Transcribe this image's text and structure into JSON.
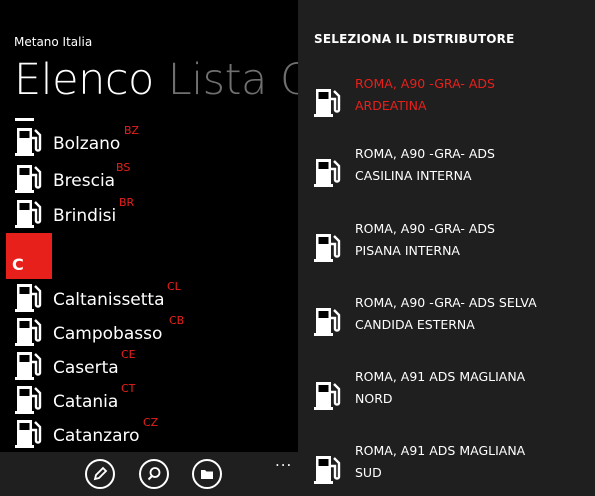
{
  "app": {
    "title": "Metano Italia",
    "pivot_active": "Elenco",
    "pivot_next": "Lista Ce"
  },
  "cities": [
    {
      "name": "Bolzano",
      "abbr": "BZ"
    },
    {
      "name": "Brescia",
      "abbr": "BS"
    },
    {
      "name": "Brindisi",
      "abbr": "BR"
    },
    {
      "name": "Caltanissetta",
      "abbr": "CL"
    },
    {
      "name": "Campobasso",
      "abbr": "CB"
    },
    {
      "name": "Caserta",
      "abbr": "CE"
    },
    {
      "name": "Catania",
      "abbr": "CT"
    },
    {
      "name": "Catanzaro",
      "abbr": "CZ"
    }
  ],
  "group_header": "C",
  "appbar": {
    "buttons": [
      "pencil-icon",
      "search-icon",
      "folder-icon"
    ],
    "more": "..."
  },
  "popup": {
    "title": "SELEZIONA IL DISTRIBUTORE",
    "stations": [
      {
        "line1": "ROMA, A90 -GRA- ADS",
        "line2": "ARDEATINA",
        "selected": true
      },
      {
        "line1": "ROMA, A90 -GRA- ADS",
        "line2": "CASILINA INTERNA",
        "selected": false
      },
      {
        "line1": "ROMA, A90 -GRA- ADS",
        "line2": "PISANA INTERNA",
        "selected": false
      },
      {
        "line1": "ROMA, A90 -GRA- ADS SELVA",
        "line2": "CANDIDA ESTERNA",
        "selected": false
      },
      {
        "line1": "ROMA, A91 ADS MAGLIANA",
        "line2": "NORD",
        "selected": false
      },
      {
        "line1": "ROMA, A91 ADS MAGLIANA",
        "line2": "SUD",
        "selected": false
      }
    ]
  },
  "colors": {
    "accent": "#e8201b",
    "background": "#000000",
    "popup_background": "#1f1f1f",
    "inactive_text": "#707070"
  }
}
